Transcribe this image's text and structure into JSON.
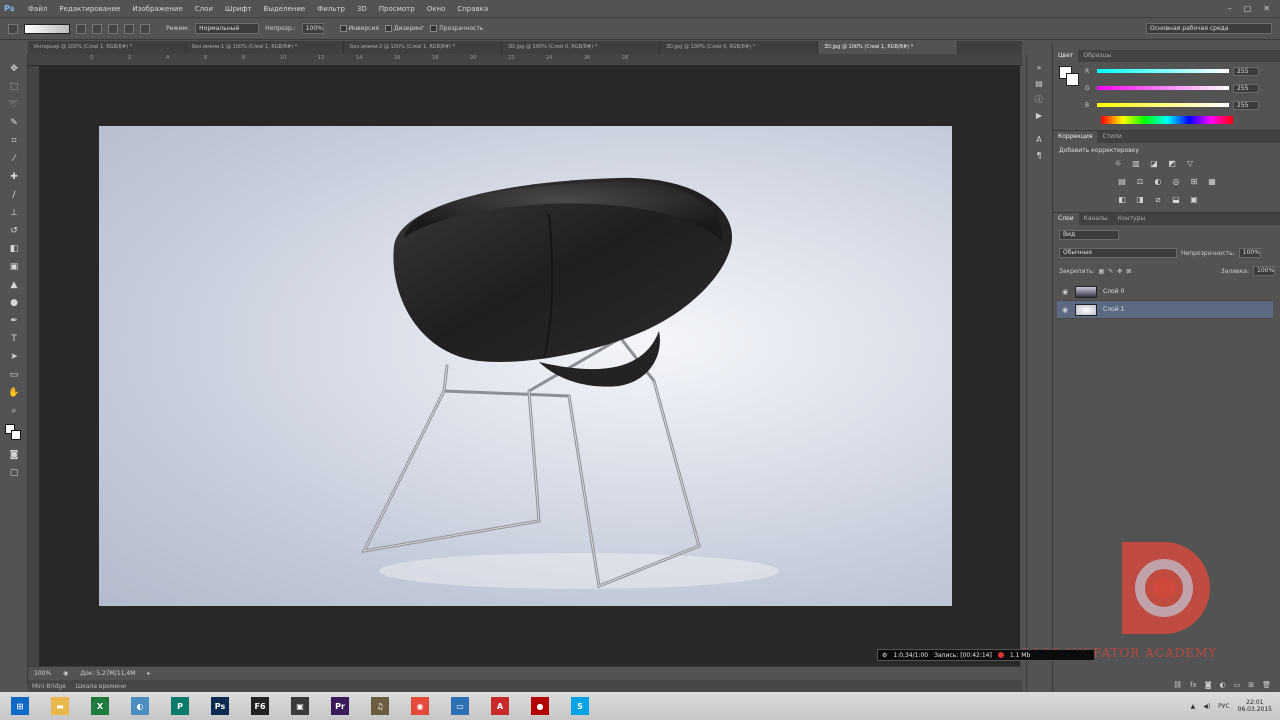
{
  "app": {
    "logo": "Ps"
  },
  "menu": [
    "Файл",
    "Редактирование",
    "Изображение",
    "Слои",
    "Шрифт",
    "Выделение",
    "Фильтр",
    "3D",
    "Просмотр",
    "Окно",
    "Справка"
  ],
  "window_controls": {
    "minimize": "–",
    "maximize": "□",
    "close": "✕"
  },
  "options_bar": {
    "mode_label": "Режим:",
    "mode_value": "Нормальный",
    "opacity_label": "Непрозр.:",
    "opacity_value": "100%",
    "inverse_label": "Инверсия",
    "dither_label": "Дизеринг",
    "transparency_label": "Прозрачность",
    "workspace_value": "Основная рабочая среда"
  },
  "tabs": [
    {
      "label": "Интерьер @ 100% (Слой 1, RGB/8#) *"
    },
    {
      "label": "Без имени-1 @ 100% (Слой 1, RGB/8#) *"
    },
    {
      "label": "Без имени-2 @ 100% (Слой 1, RGB/8#) *"
    },
    {
      "label": "3D.jpg @ 100% (Слой 0, RGB/8#) *"
    },
    {
      "label": "3D.jpg @ 100% (Слой 0, RGB/8#) *"
    },
    {
      "label": "3D.jpg @ 100% (Слой 1, RGB/8#) *"
    }
  ],
  "ruler_numbers": [
    "0",
    "2",
    "4",
    "6",
    "8",
    "10",
    "12",
    "14",
    "16",
    "18",
    "20",
    "22",
    "24",
    "26",
    "28"
  ],
  "status": {
    "zoom": "100%",
    "doc_size": "Док: 5,27M/11,4M"
  },
  "mini_bridge": {
    "tab1": "Mini Bridge",
    "tab2": "Шкала времени"
  },
  "color_panel": {
    "tab_color": "Цвет",
    "tab_swatches": "Образцы",
    "rows": [
      {
        "letter": "R",
        "value": "255",
        "gradient": "#44d9c8"
      },
      {
        "letter": "G",
        "value": "255",
        "gradient": "#d94ad4"
      },
      {
        "letter": "B",
        "value": "255",
        "gradient": "#e6e62a"
      }
    ]
  },
  "adjustments_panel": {
    "tab_adjustments": "Коррекция",
    "tab_styles": "Стили",
    "title": "Добавить корректировку",
    "row1": [
      "☼",
      "▥",
      "◪",
      "◩",
      "▽"
    ],
    "row2": [
      "▤",
      "⚖",
      "◐",
      "◎",
      "⊞",
      "▦"
    ],
    "row3": [
      "◧",
      "◨",
      "⧄",
      "⬓",
      "▣"
    ]
  },
  "layers_panel": {
    "tab_layers": "Слои",
    "tab_channels": "Каналы",
    "tab_paths": "Контуры",
    "filter_value": "Вид",
    "blend_value": "Обычные",
    "opacity_label": "Непрозрачность:",
    "opacity_value": "100%",
    "lock_label": "Закрепить:",
    "fill_label": "Заливка:",
    "fill_value": "100%",
    "layers": [
      {
        "name": "Слой 0",
        "selected": false
      },
      {
        "name": "Слой 1",
        "selected": true
      }
    ]
  },
  "recording": {
    "time_label": "1:0,34/1:00",
    "status_label": "Запись: [00:42:14]",
    "size": "1.1 Mb"
  },
  "watermark": {
    "text": "GOODSURFATOR ACADEMY",
    "color": "#cf4a3d"
  },
  "taskbar": {
    "icons": [
      {
        "name": "windows-start-icon",
        "bg": "#0f68c4",
        "glyph": "⊞"
      },
      {
        "name": "file-explorer-icon",
        "bg": "#e9b84b",
        "glyph": "▬"
      },
      {
        "name": "excel-icon",
        "bg": "#1f7a3e",
        "glyph": "X"
      },
      {
        "name": "chrome-remote-icon",
        "bg": "#4a8fbf",
        "glyph": "◐"
      },
      {
        "name": "publisher-icon",
        "bg": "#0a7a6a",
        "glyph": "P"
      },
      {
        "name": "photoshop-icon",
        "bg": "#0a2a50",
        "glyph": "Ps"
      },
      {
        "name": "f6-app-icon",
        "bg": "#222222",
        "glyph": "F6"
      },
      {
        "name": "scanner-icon",
        "bg": "#3a3a3a",
        "glyph": "▣"
      },
      {
        "name": "premiere-icon",
        "bg": "#3b1a5a",
        "glyph": "Pr"
      },
      {
        "name": "media-manager-icon",
        "bg": "#6b5d3f",
        "glyph": "♫"
      },
      {
        "name": "chrome-icon",
        "bg": "#e24b3b",
        "glyph": "◉"
      },
      {
        "name": "remote-desktop-icon",
        "bg": "#2d6fb3",
        "glyph": "▭"
      },
      {
        "name": "acrobat-icon",
        "bg": "#c62a2a",
        "glyph": "A"
      },
      {
        "name": "recorder-icon",
        "bg": "#b20000",
        "glyph": "●"
      },
      {
        "name": "skype-icon",
        "bg": "#00a4e4",
        "glyph": "S"
      }
    ],
    "tray_lang": "РУС",
    "time": "22:01",
    "date": "06.03.2015"
  }
}
